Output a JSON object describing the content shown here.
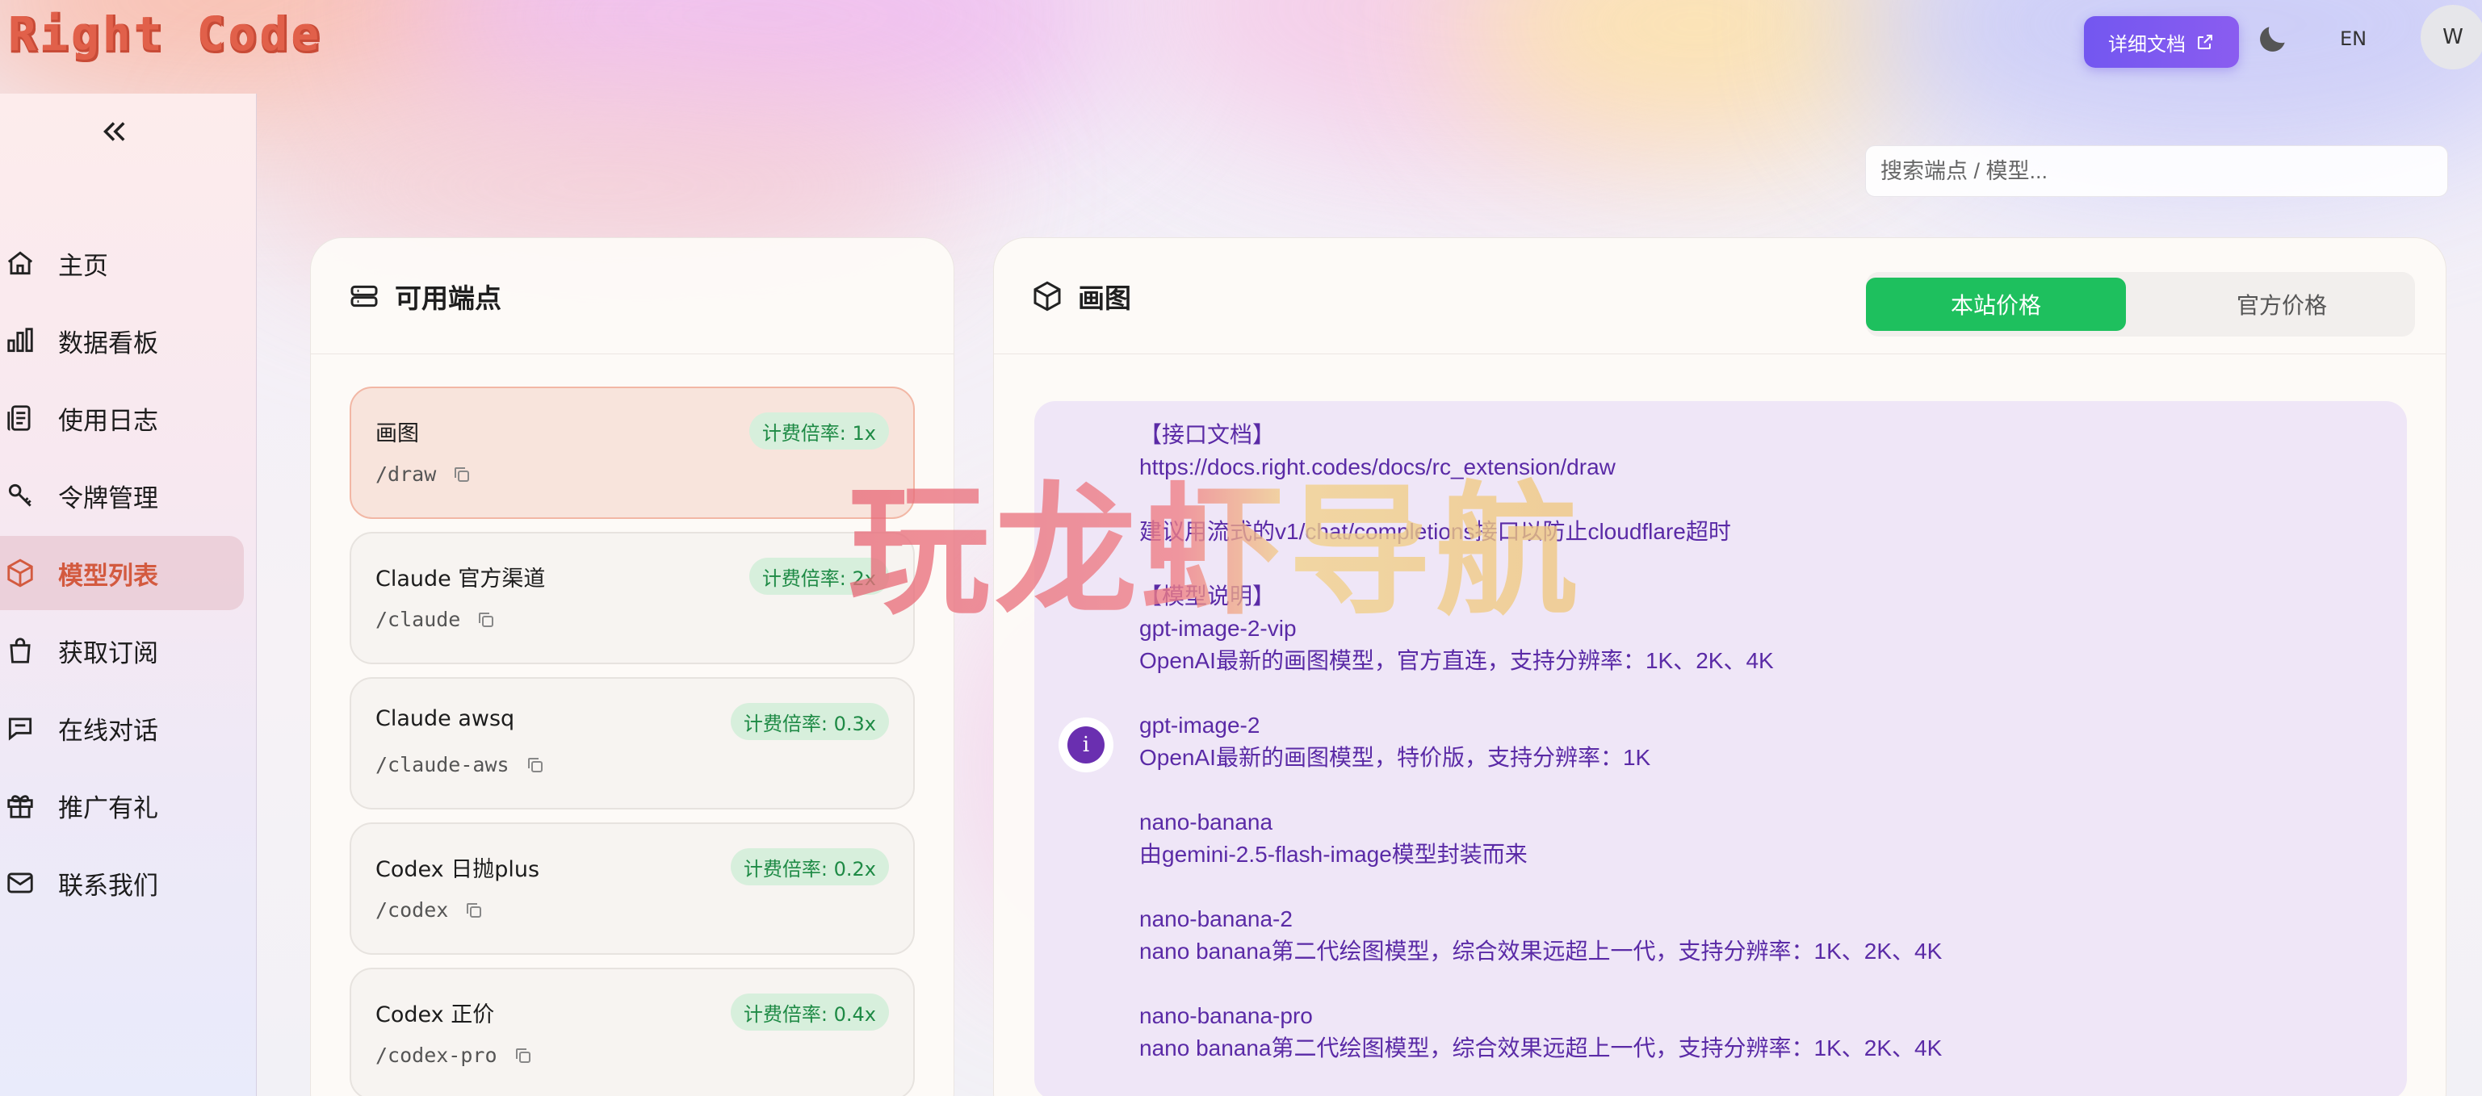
{
  "header": {
    "logo": "Right Code",
    "docs_button": "详细文档",
    "lang": "EN",
    "avatar_initial": "W"
  },
  "sidebar": {
    "items": [
      {
        "label": "主页",
        "icon": "home-icon"
      },
      {
        "label": "数据看板",
        "icon": "bar-chart-icon"
      },
      {
        "label": "使用日志",
        "icon": "log-icon"
      },
      {
        "label": "令牌管理",
        "icon": "key-icon"
      },
      {
        "label": "模型列表",
        "icon": "cube-icon",
        "active": true
      },
      {
        "label": "获取订阅",
        "icon": "shopping-bag-icon"
      },
      {
        "label": "在线对话",
        "icon": "chat-icon"
      },
      {
        "label": "推广有礼",
        "icon": "gift-icon"
      },
      {
        "label": "联系我们",
        "icon": "mail-icon"
      }
    ]
  },
  "search": {
    "placeholder": "搜索端点 / 模型..."
  },
  "endpoints_panel": {
    "title": "可用端点",
    "items": [
      {
        "name": "画图",
        "path": "/draw",
        "rate": "计费倍率: 1x",
        "active": true
      },
      {
        "name": "Claude 官方渠道",
        "path": "/claude",
        "rate": "计费倍率: 2x"
      },
      {
        "name": "Claude awsq",
        "path": "/claude-aws",
        "rate": "计费倍率: 0.3x"
      },
      {
        "name": "Codex 日抛plus",
        "path": "/codex",
        "rate": "计费倍率: 0.2x"
      },
      {
        "name": "Codex 正价",
        "path": "/codex-pro",
        "rate": "计费倍率: 0.4x"
      }
    ]
  },
  "detail_panel": {
    "title": "画图",
    "tabs": {
      "site_price": "本站价格",
      "official_price": "官方价格"
    },
    "lines": [
      "【接口文档】",
      "https://docs.right.codes/docs/rc_extension/draw",
      "",
      "建议用流式的v1/chat/completions接口以防止cloudflare超时",
      "",
      "【模型说明】",
      "gpt-image-2-vip",
      "OpenAI最新的画图模型，官方直连，支持分辨率：1K、2K、4K",
      "",
      "gpt-image-2",
      "OpenAI最新的画图模型，特价版，支持分辨率：1K",
      "",
      "nano-banana",
      "由gemini-2.5-flash-image模型封装而来",
      "",
      "nano-banana-2",
      "nano banana第二代绘图模型，综合效果远超上一代，支持分辨率：1K、2K、4K",
      "",
      "nano-banana-pro",
      "nano banana第二代绘图模型，综合效果远超上一代，支持分辨率：1K、2K、4K"
    ]
  },
  "watermark": "玩龙虾导航",
  "colors": {
    "accent_purple": "#7357f0",
    "active_nav": "#d35a3f",
    "tab_green": "#1ec05e",
    "badge_green": "#1e8a45",
    "text_purple": "#5a2aa6"
  }
}
